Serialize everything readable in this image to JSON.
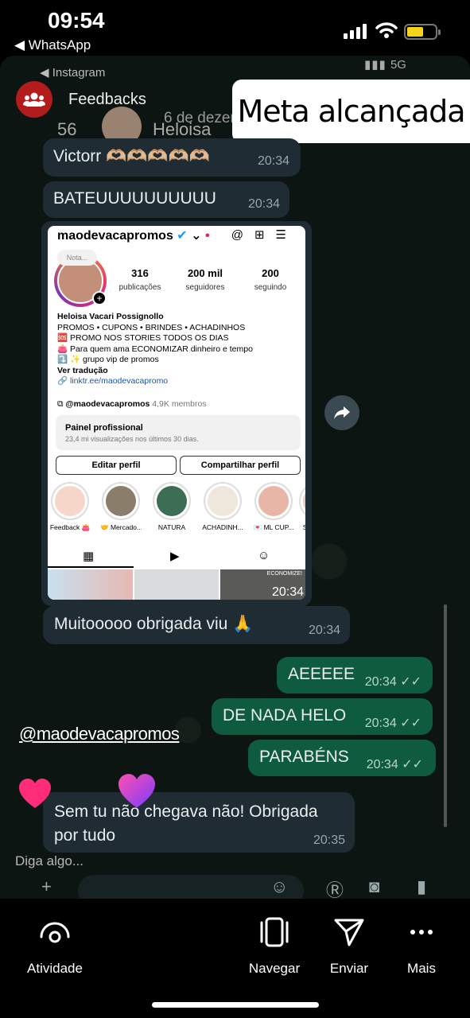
{
  "status_bar": {
    "time": "09:54",
    "back_app": "◀ WhatsApp"
  },
  "inner_status": {
    "app": "◀ Instagram",
    "network": "5G"
  },
  "story": {
    "group_name": "Feedbacks",
    "ghost_count": "56",
    "ghost_name": "Heloisa",
    "ghost_date": "6 de dezembro de 2024",
    "sticker": "Meta alcançada",
    "mention": "@maodevacapromos",
    "reply_placeholder": "Diga algo..."
  },
  "messages": [
    {
      "text": "Victorr 🫶🏼🫶🏼🫶🏼🫶🏼🫶🏼",
      "time": "20:34",
      "dir": "in"
    },
    {
      "text": "BATEUUUUUUUUUU",
      "time": "20:34",
      "dir": "in"
    },
    {
      "text": "Muitooooo obrigada viu 🙏",
      "time": "20:34",
      "dir": "in"
    },
    {
      "text": "AEEEEE",
      "time": "20:34",
      "dir": "out"
    },
    {
      "text": "DE NADA HELO",
      "time": "20:34",
      "dir": "out"
    },
    {
      "text": "PARABÉNS",
      "time": "20:34",
      "dir": "out"
    },
    {
      "text": "Sem tu não chegava não! Obrigada por tudo",
      "time": "20:35",
      "dir": "in"
    }
  ],
  "screenshot": {
    "time": "20:34",
    "username": "maodevacapromos",
    "note": "Nota...",
    "stats": [
      {
        "value": "316",
        "label": "publicações"
      },
      {
        "value": "200 mil",
        "label": "seguidores"
      },
      {
        "value": "200",
        "label": "seguindo"
      }
    ],
    "bio_name": "Heloisa Vacari Possignollo",
    "bio_lines": [
      "PROMOS • CUPONS • BRINDES • ACHADINHOS",
      "🆘 PROMO NOS STORIES TODOS OS DIAS",
      "👛 Para quem ama ECONOMIZAR dinheiro e tempo",
      "⤵️ ✨ grupo vip de promos"
    ],
    "translate": "Ver tradução",
    "link": "linktr.ee/maodevacapromo",
    "community_name": "@maodevacapromos",
    "community_members": "4,9K membros",
    "panel_title": "Painel profissional",
    "panel_sub": "23,4 mi visualizações nos últimos 30 dias.",
    "btn_edit": "Editar perfil",
    "btn_share": "Compartilhar perfil",
    "highlights": [
      "Feedback 👛",
      "🤝 Mercado...",
      "NATURA",
      "ACHADINH...",
      "💌 ML CUP...",
      "So"
    ],
    "grid_tag": "ECONOMIZE!"
  },
  "bottom_nav": {
    "activity": "Atividade",
    "browse": "Navegar",
    "send": "Enviar",
    "more": "Mais"
  },
  "colors": {
    "outgoing": "#0f5b40",
    "incoming": "#1f2c33",
    "battery": "#f7d21b",
    "group_avatar": "#b21c1c"
  }
}
